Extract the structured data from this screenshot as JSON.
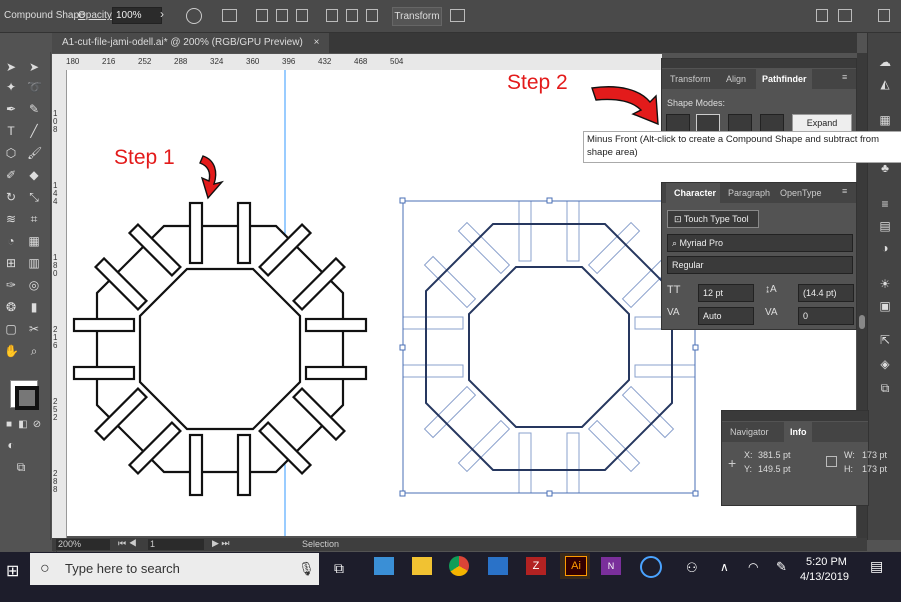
{
  "control_bar": {
    "selection_type": "Compound Shape",
    "opacity_label": "Opacity:",
    "opacity_value": "100%",
    "transform_label": "Transform"
  },
  "document": {
    "tab_title": "A1-cut-file-jami-odell.ai* @ 200% (RGB/GPU Preview)",
    "close_symbol": "×"
  },
  "ruler": {
    "top_ticks": [
      "180",
      "216",
      "252",
      "288",
      "324",
      "360",
      "396",
      "432",
      "468",
      "504"
    ],
    "left_ticks": [
      "108",
      "144",
      "180",
      "216",
      "252",
      "288",
      "324"
    ]
  },
  "annotations": {
    "step1": "Step 1",
    "step2": "Step 2",
    "color": "#e31b1b"
  },
  "pathfinder_panel": {
    "tabs": [
      "Transform",
      "Align",
      "Pathfinder"
    ],
    "active_tab": "Pathfinder",
    "shape_modes_label": "Shape Modes:",
    "expand_label": "Expand"
  },
  "tooltip": {
    "text": "Minus Front (Alt-click to create a Compound Shape and subtract from shape area)"
  },
  "character_panel": {
    "tabs": [
      "Character",
      "Paragraph",
      "OpenType"
    ],
    "touch_type_label": "Touch Type Tool",
    "font_family": "Myriad Pro",
    "font_style": "Regular",
    "font_size": "12 pt",
    "leading": "(14.4 pt)",
    "kerning": "Auto",
    "tracking": "0"
  },
  "info_panel": {
    "tabs": [
      "Navigator",
      "Info"
    ],
    "x": "381.5 pt",
    "y": "149.5 pt",
    "w": "173 pt",
    "h": "173 pt",
    "x_label": "X:",
    "y_label": "Y:",
    "w_label": "W:",
    "h_label": "H:"
  },
  "status_bar": {
    "zoom": "200%",
    "page": "1",
    "tool": "Selection"
  },
  "taskbar": {
    "search_placeholder": "Type here to search",
    "time": "5:20 PM",
    "date": "4/13/2019"
  },
  "colors": {
    "selection_blue": "#4a6fb5",
    "guide": "#3399ff"
  }
}
